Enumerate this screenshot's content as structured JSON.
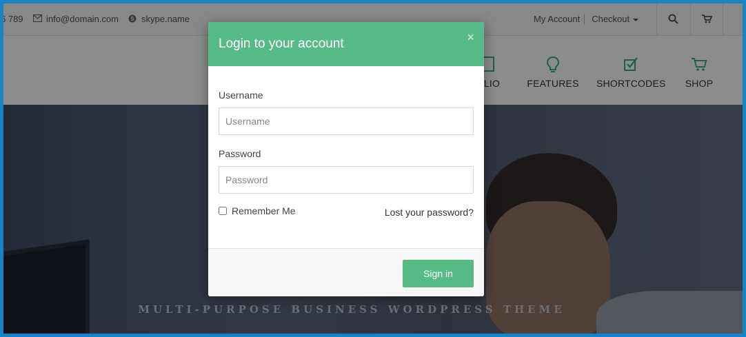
{
  "topbar": {
    "phone": "6 789",
    "email": "info@domain.com",
    "skype": "skype.name",
    "my_account": "My Account",
    "checkout": "Checkout"
  },
  "nav": {
    "portfolio": "OLIO",
    "features": "FEATURES",
    "shortcodes": "SHORTCODES",
    "shop": "SHOP"
  },
  "hero": {
    "tagline": "MULTI-PURPOSE BUSINESS WORDPRESS THEME"
  },
  "modal": {
    "title": "Login to your account",
    "close": "×",
    "username_label": "Username",
    "username_placeholder": "Username",
    "username_value": "",
    "password_label": "Password",
    "password_placeholder": "Password",
    "password_value": "",
    "remember_label": "Remember Me",
    "remember_checked": false,
    "lost_password": "Lost your password?",
    "signin": "Sign in"
  },
  "colors": {
    "accent": "#56bb87",
    "frame": "#1583c5"
  },
  "icons": [
    "mail-icon",
    "skype-icon",
    "search-icon",
    "cart-icon",
    "lightbulb-icon",
    "checkbox-icon",
    "shop-cart-icon",
    "close-icon"
  ]
}
